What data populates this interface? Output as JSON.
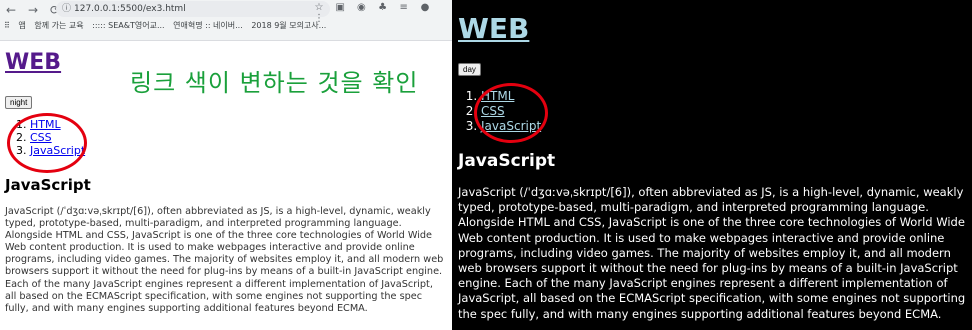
{
  "browser": {
    "url": "127.0.0.1:5500/ex3.html",
    "bookmarks": [
      "앱",
      "함께 가는 교육",
      "::::: SEA&T영어교...",
      "연애혁명 :: 네이버...",
      "2018 9월 모의고사..."
    ]
  },
  "annotation": "링크 색이 변하는 것을 확인",
  "light": {
    "heading": "WEB",
    "button_label": "night",
    "links": [
      "HTML",
      "CSS",
      "JavaScript"
    ],
    "section_title": "JavaScript",
    "body": "JavaScript (/ˈdʒɑːvəˌskrɪpt/[6]), often abbreviated as JS, is a high-level, dynamic, weakly typed, prototype-based, multi-paradigm, and interpreted programming language. Alongside HTML and CSS, JavaScript is one of the three core technologies of World Wide Web content production. It is used to make webpages interactive and provide online programs, including video games. The majority of websites employ it, and all modern web browsers support it without the need for plug-ins by means of a built-in JavaScript engine. Each of the many JavaScript engines represent a different implementation of JavaScript, all based on the ECMAScript specification, with some engines not supporting the spec fully, and with many engines supporting additional features beyond ECMA."
  },
  "dark": {
    "heading": "WEB",
    "button_label": "day",
    "links": [
      "HTML",
      "CSS",
      "JavaScript"
    ],
    "section_title": "JavaScript",
    "body": "JavaScript (/ˈdʒɑːvəˌskrɪpt/[6]), often abbreviated as JS, is a high-level, dynamic, weakly typed, prototype-based, multi-paradigm, and interpreted programming language. Alongside HTML and CSS, JavaScript is one of the three core technologies of World Wide Web content production. It is used to make webpages interactive and provide online programs, including video games. The majority of websites employ it, and all modern web browsers support it without the need for plug-ins by means of a built-in JavaScript engine. Each of the many JavaScript engines represent a different implementation of JavaScript, all based on the ECMAScript specification, with some engines not supporting the spec fully, and with many engines supporting additional features beyond ECMA."
  },
  "colors": {
    "annotation": "#1aa03b",
    "highlight_ring": "#e4000f",
    "light_link": "#0000ee",
    "light_visited": "#551a8b",
    "dark_link": "#add8e6",
    "dark_background": "#000000"
  },
  "icons": [
    "back-arrow-icon",
    "forward-arrow-icon",
    "reload-icon",
    "info-icon",
    "star-icon",
    "extensions-icon",
    "profile-icon",
    "menu-icon",
    "apps-icon"
  ]
}
